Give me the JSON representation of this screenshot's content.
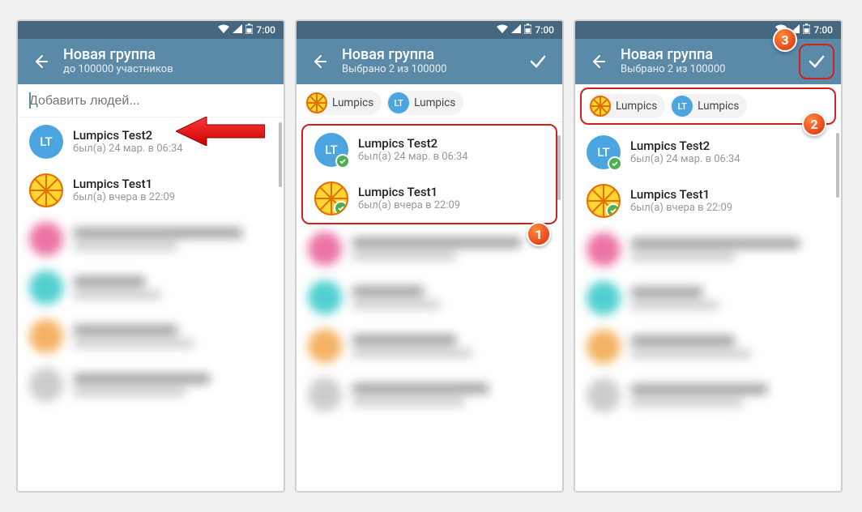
{
  "status": {
    "time": "7:00"
  },
  "screen1": {
    "title": "Новая группа",
    "subtitle": "до 100000 участников",
    "search_placeholder": "Добавить людей...",
    "contacts": [
      {
        "name": "Lumpics Test2",
        "status": "был(а) 24 мар. в 06:34",
        "initials": "LT",
        "color": "#4aa5e0"
      },
      {
        "name": "Lumpics Test1",
        "status": "был(а) вчера в 22:09",
        "avatar": "lemon"
      }
    ]
  },
  "screen2": {
    "title": "Новая группа",
    "subtitle": "Выбрано 2 из 100000",
    "chips": [
      {
        "label": "Lumpics",
        "avatar": "lemon"
      },
      {
        "label": "Lumpics",
        "initials": "LT",
        "color": "#4aa5e0"
      }
    ],
    "contacts": [
      {
        "name": "Lumpics Test2",
        "status": "был(а) 24 мар. в 06:34",
        "initials": "LT",
        "color": "#4aa5e0",
        "checked": true
      },
      {
        "name": "Lumpics Test1",
        "status": "был(а) вчера в 22:09",
        "avatar": "lemon",
        "checked": true
      }
    ],
    "badge": "1"
  },
  "screen3": {
    "title": "Новая группа",
    "subtitle": "Выбрано 2 из 100000",
    "chips": [
      {
        "label": "Lumpics",
        "avatar": "lemon"
      },
      {
        "label": "Lumpics",
        "initials": "LT",
        "color": "#4aa5e0"
      }
    ],
    "contacts": [
      {
        "name": "Lumpics Test2",
        "status": "был(а) 24 мар. в 06:34",
        "initials": "LT",
        "color": "#4aa5e0",
        "checked": true
      },
      {
        "name": "Lumpics Test1",
        "status": "был(а) вчера в 22:09",
        "avatar": "lemon",
        "checked": true
      }
    ],
    "badge_chips": "2",
    "badge_check": "3"
  },
  "blurred": [
    {
      "color": "#e8528f",
      "w1": "210px",
      "w2": "130px"
    },
    {
      "color": "#26c4c4",
      "w1": "90px",
      "w2": "110px"
    },
    {
      "color": "#f2a03d",
      "w1": "130px",
      "w2": "150px"
    },
    {
      "color": "#c0c0c0",
      "w1": "170px",
      "w2": "140px"
    }
  ]
}
